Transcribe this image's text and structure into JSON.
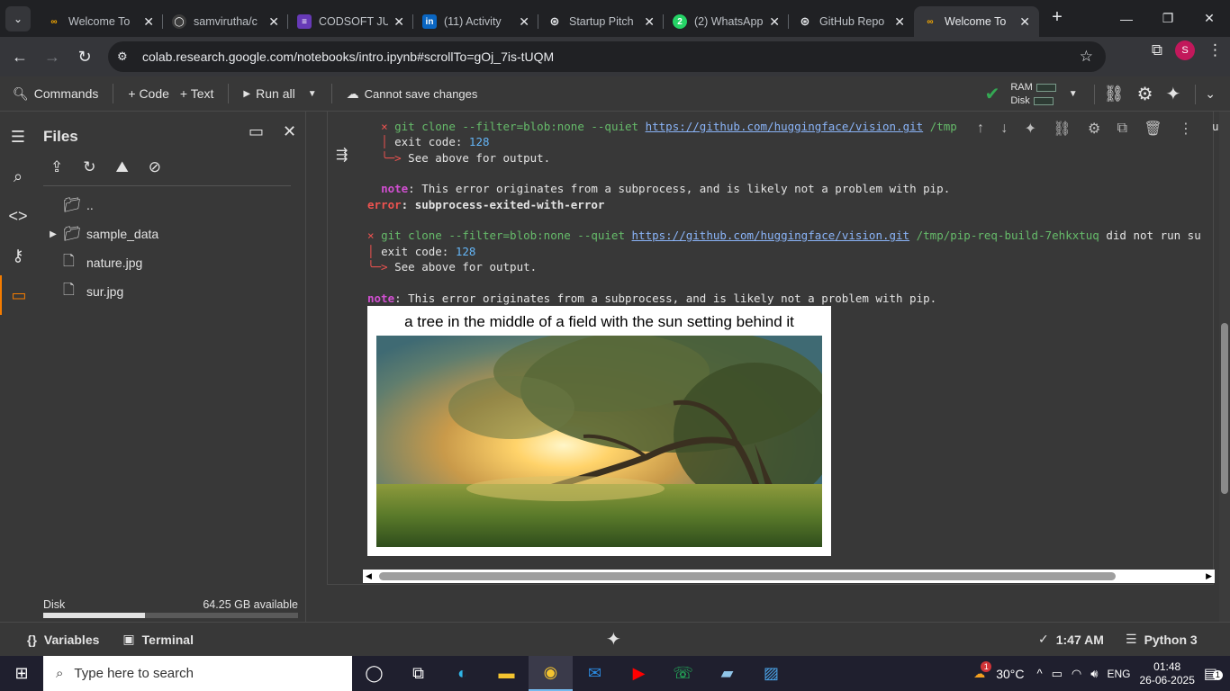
{
  "browser": {
    "tabs": [
      {
        "title": "Welcome To",
        "favicon": "colab-icon",
        "active": false
      },
      {
        "title": "samvirutha/c",
        "favicon": "github-icon",
        "active": false
      },
      {
        "title": "CODSOFT JU",
        "favicon": "forms-icon",
        "active": false
      },
      {
        "title": "(11) Activity",
        "favicon": "linkedin-icon",
        "active": false
      },
      {
        "title": "Startup Pitch",
        "favicon": "chatgpt-icon",
        "active": false
      },
      {
        "title": "(2) WhatsApp",
        "favicon": "whatsapp-icon",
        "active": false
      },
      {
        "title": "GitHub Repo",
        "favicon": "chatgpt-icon",
        "active": false
      },
      {
        "title": "Welcome To",
        "favicon": "colab-icon",
        "active": true
      }
    ],
    "url": "colab.research.google.com/notebooks/intro.ipynb#scrollTo=gOj_7is-tUQM",
    "profile_initial": "S"
  },
  "toolbar": {
    "commands": "Commands",
    "code": "+ Code",
    "text": "+ Text",
    "run_all": "Run all",
    "cannot_save": "Cannot save changes",
    "ram": "RAM",
    "disk": "Disk"
  },
  "files": {
    "title": "Files",
    "items": [
      {
        "name": "..",
        "type": "folder-up"
      },
      {
        "name": "sample_data",
        "type": "folder"
      },
      {
        "name": "nature.jpg",
        "type": "file"
      },
      {
        "name": "sur.jpg",
        "type": "file"
      }
    ],
    "disk_label": "Disk",
    "disk_available": "64.25 GB available",
    "disk_used_fraction": 0.4
  },
  "output": {
    "line1_x": "×",
    "line1_cmd": "git clone --filter=blob:none --quiet",
    "line1_url": "https://github.com/huggingface/vision.git",
    "line1_rest": "/tmp",
    "line1_tail": "un",
    "line2": "exit code: ",
    "line2_code": "128",
    "line3": "See above for output.",
    "note_label": "note",
    "note_text": ": This error originates from a subprocess, and is likely not a problem with pip.",
    "error_label": "error",
    "error_text": ": subprocess-exited-with-error",
    "line4_cmd": "git clone --filter=blob:none --quiet",
    "line4_url": "https://github.com/huggingface/vision.git",
    "line4_rest": "/tmp/pip-req-build-7ehkxtuq",
    "line4_tail": "did not run su",
    "caption": "a tree in the middle of a field with the sun setting behind it"
  },
  "statusbar": {
    "variables": "Variables",
    "terminal": "Terminal",
    "time": "1:47 AM",
    "runtime": "Python 3"
  },
  "taskbar": {
    "search_placeholder": "Type here to search",
    "temperature": "30°C",
    "language": "ENG",
    "time": "01:48",
    "date": "26-06-2025",
    "weather_badge": "1",
    "notif_count": "1"
  },
  "colors": {
    "accent": "#f57c00",
    "error_red": "#ef5350",
    "note_magenta": "#d24fd2",
    "link_blue": "#8ab4f8",
    "success_green": "#34a853"
  }
}
